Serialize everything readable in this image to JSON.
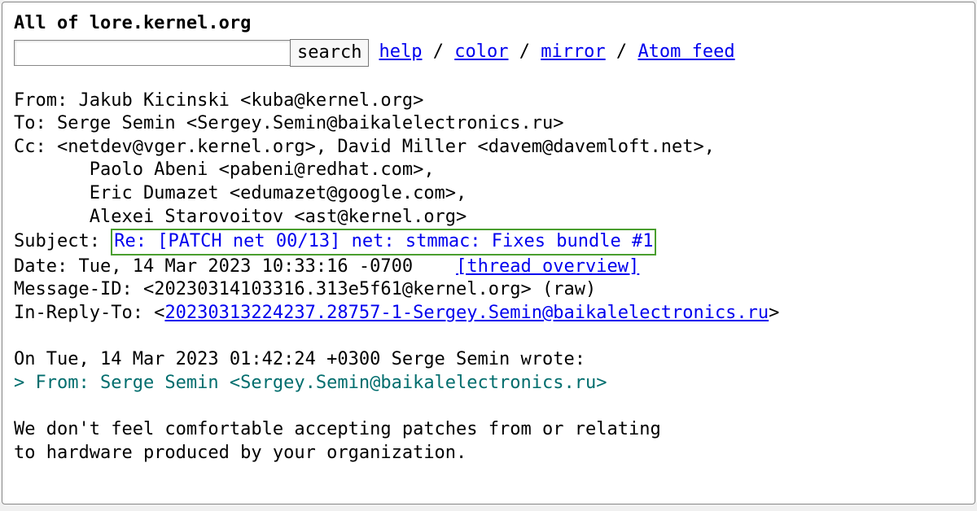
{
  "title": "All of lore.kernel.org",
  "search": {
    "button_label": "search"
  },
  "nav": {
    "help": "help",
    "color": "color",
    "mirror": "mirror",
    "atom": "Atom feed",
    "sep": " / "
  },
  "headers": {
    "from_label": "From: ",
    "from_value": "Jakub Kicinski <kuba@kernel.org>",
    "to_label": "To: ",
    "to_value": "Serge Semin <Sergey.Semin@baikalelectronics.ru>",
    "cc_label": "Cc: ",
    "cc_line1": "<netdev@vger.kernel.org>, David Miller <davem@davemloft.net>,",
    "cc_line2": "       Paolo Abeni <pabeni@redhat.com>,",
    "cc_line3": "       Eric Dumazet <edumazet@google.com>,",
    "cc_line4": "       Alexei Starovoitov <ast@kernel.org>",
    "subject_label": "Subject: ",
    "subject_value": "Re: [PATCH net 00/13] net: stmmac: Fixes bundle #1",
    "date_label": "Date: ",
    "date_value": "Tue, 14 Mar 2023 10:33:16 -0700",
    "thread_overview": "[thread overview]",
    "msgid_label": "Message-ID: ",
    "msgid_value": "<20230314103316.313e5f61@kernel.org> (raw)",
    "in_reply_to_label": "In-Reply-To: <",
    "in_reply_to_link": "20230313224237.28757-1-Sergey.Semin@baikalelectronics.ru",
    "in_reply_to_close": ">"
  },
  "body": {
    "intro": "On Tue, 14 Mar 2023 01:42:24 +0300 Serge Semin wrote:",
    "quote1": "> From: Serge Semin <Sergey.Semin@baikalelectronics.ru>",
    "para1": "We don't feel comfortable accepting patches from or relating",
    "para2": "to hardware produced by your organization."
  }
}
